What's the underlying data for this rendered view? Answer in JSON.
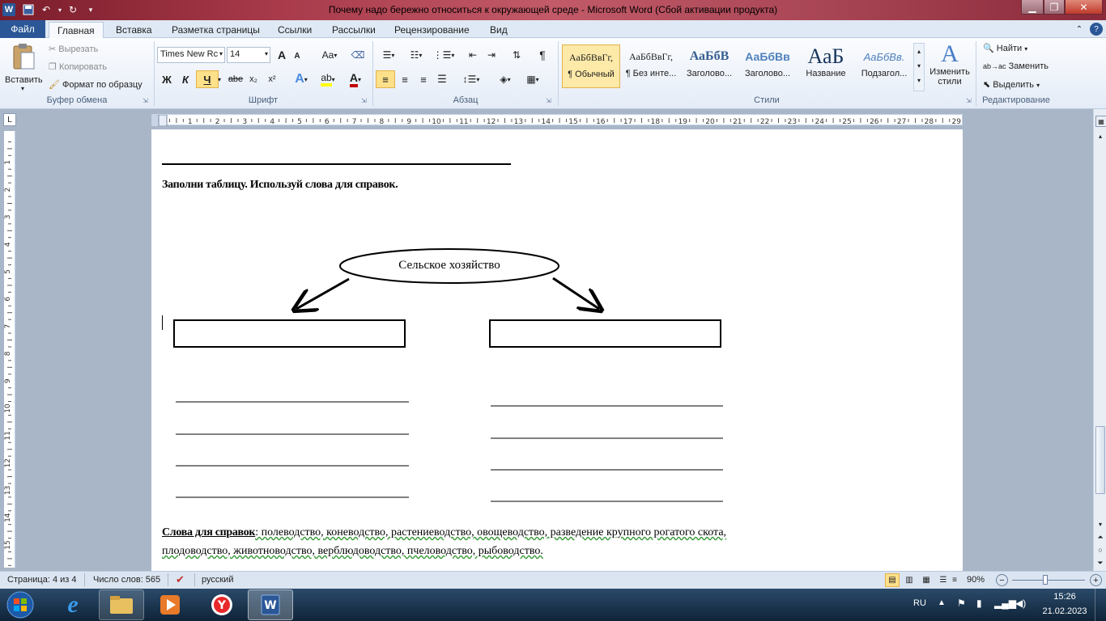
{
  "window": {
    "title": "Почему надо бережно относиться к окружающей среде - Microsoft Word (Сбой активации продукта)"
  },
  "tabs": {
    "file": "Файл",
    "items": [
      "Главная",
      "Вставка",
      "Разметка страницы",
      "Ссылки",
      "Рассылки",
      "Рецензирование",
      "Вид"
    ]
  },
  "ribbon": {
    "clipboard": {
      "paste": "Вставить",
      "cut": "Вырезать",
      "copy": "Копировать",
      "format_painter": "Формат по образцу",
      "label": "Буфер обмена"
    },
    "font": {
      "name": "Times New Rc",
      "size": "14",
      "bold": "Ж",
      "italic": "К",
      "underline": "Ч",
      "strike": "abe",
      "sub": "x₂",
      "sup": "x²",
      "grow": "A",
      "shrink": "A",
      "case": "Aa",
      "label": "Шрифт"
    },
    "paragraph": {
      "pilcrow": "¶",
      "label": "Абзац"
    },
    "styles": {
      "items": [
        {
          "sample": "АаБбВвГг,",
          "name": "¶ Обычный"
        },
        {
          "sample": "АаБбВвГг,",
          "name": "¶ Без инте..."
        },
        {
          "sample": "АаБбВ",
          "name": "Заголово..."
        },
        {
          "sample": "АаБбВв",
          "name": "Заголово..."
        },
        {
          "sample": "АаБ",
          "name": "Название"
        },
        {
          "sample": "АаБбВв.",
          "name": "Подзагол..."
        }
      ],
      "change_styles": "Изменить стили",
      "label": "Стили"
    },
    "editing": {
      "find": "Найти",
      "replace": "Заменить",
      "select": "Выделить",
      "label": "Редактирование"
    }
  },
  "ruler": {
    "ticks": [
      "1",
      "2",
      "3",
      "4",
      "5",
      "6",
      "7",
      "8",
      "9",
      "10",
      "11",
      "12",
      "13",
      "14",
      "15",
      "16",
      "17",
      "18",
      "19",
      "20",
      "21",
      "22",
      "23",
      "24",
      "25",
      "26",
      "27",
      "28",
      "29"
    ],
    "vticks": [
      "1",
      "2",
      "3",
      "4",
      "5",
      "6",
      "7",
      "8",
      "9",
      "10",
      "11",
      "12",
      "13",
      "14",
      "15",
      "16"
    ]
  },
  "document": {
    "instruction": "Заполни таблицу. Используй слова для справок.",
    "oval_label": "Сельское хозяйство",
    "hint_label": "Слова для справок",
    "hint_text": ": полеводство, коневодство, растениеводство, овощеводство, разведение крупного рогатого скота, плодоводство, животноводство, верблюдоводство, пчеловодство, рыбоводство."
  },
  "status": {
    "page": "Страница: 4 из 4",
    "words": "Число слов: 565",
    "language": "русский",
    "zoom": "90%"
  },
  "taskbar": {
    "lang": "RU",
    "time": "15:26",
    "date": "21.02.2023"
  },
  "colors": {
    "accent": "#2b5797",
    "file_tab": "#2b5797",
    "heading_blue": "#365f91"
  }
}
